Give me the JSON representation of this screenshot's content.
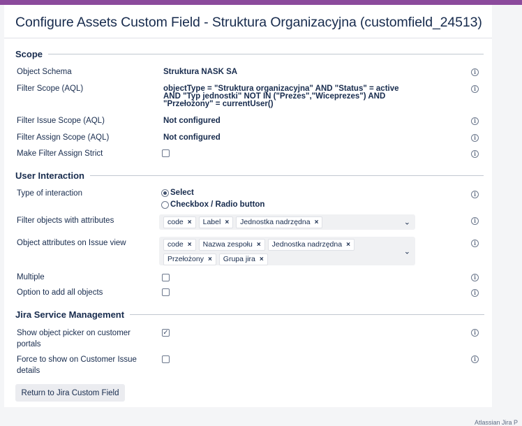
{
  "title": "Configure Assets Custom Field - Struktura Organizacyjna (customfield_24513)",
  "scope": {
    "heading": "Scope",
    "object_schema_label": "Object Schema",
    "object_schema_value": "Struktura NASK SA",
    "filter_scope_label": "Filter Scope (AQL)",
    "filter_scope_lines": [
      "objectType = \"Struktura organizacyjna\" AND \"Status\" = active",
      "AND \"Typ jednostki\" NOT IN (\"Prezes\",\"Wiceprezes\") AND",
      "\"Przełożony\" = currentUser()"
    ],
    "filter_issue_label": "Filter Issue Scope (AQL)",
    "filter_issue_value": "Not configured",
    "filter_assign_label": "Filter Assign Scope (AQL)",
    "filter_assign_value": "Not configured",
    "strict_label": "Make Filter Assign Strict",
    "strict_checked": false
  },
  "interaction": {
    "heading": "User Interaction",
    "type_label": "Type of interaction",
    "options": [
      {
        "label": "Select",
        "selected": true
      },
      {
        "label": "Checkbox / Radio button",
        "selected": false
      }
    ],
    "filter_attrs_label": "Filter objects with attributes",
    "filter_attrs": [
      "code",
      "Label",
      "Jednostka nadrzędna"
    ],
    "issue_view_label": "Object attributes on Issue view",
    "issue_view_attrs": [
      "code",
      "Nazwa zespołu",
      "Jednostka nadrzędna",
      "Przełożony",
      "Grupa jira"
    ],
    "multiple_label": "Multiple",
    "multiple_checked": false,
    "add_all_label": "Option to add all objects",
    "add_all_checked": false
  },
  "jsm": {
    "heading": "Jira Service Management",
    "picker_label_1": "Show object picker on customer",
    "picker_label_2": "portals",
    "picker_checked": true,
    "force_label_1": "Force to show on Customer Issue",
    "force_label_2": "details",
    "force_checked": false
  },
  "icons": {
    "info": "info-icon",
    "remove": "close-icon",
    "dropdown": "chevron-down-icon"
  },
  "return_button": "Return to Jira Custom Field",
  "footer_text": "Atlassian Jira P"
}
